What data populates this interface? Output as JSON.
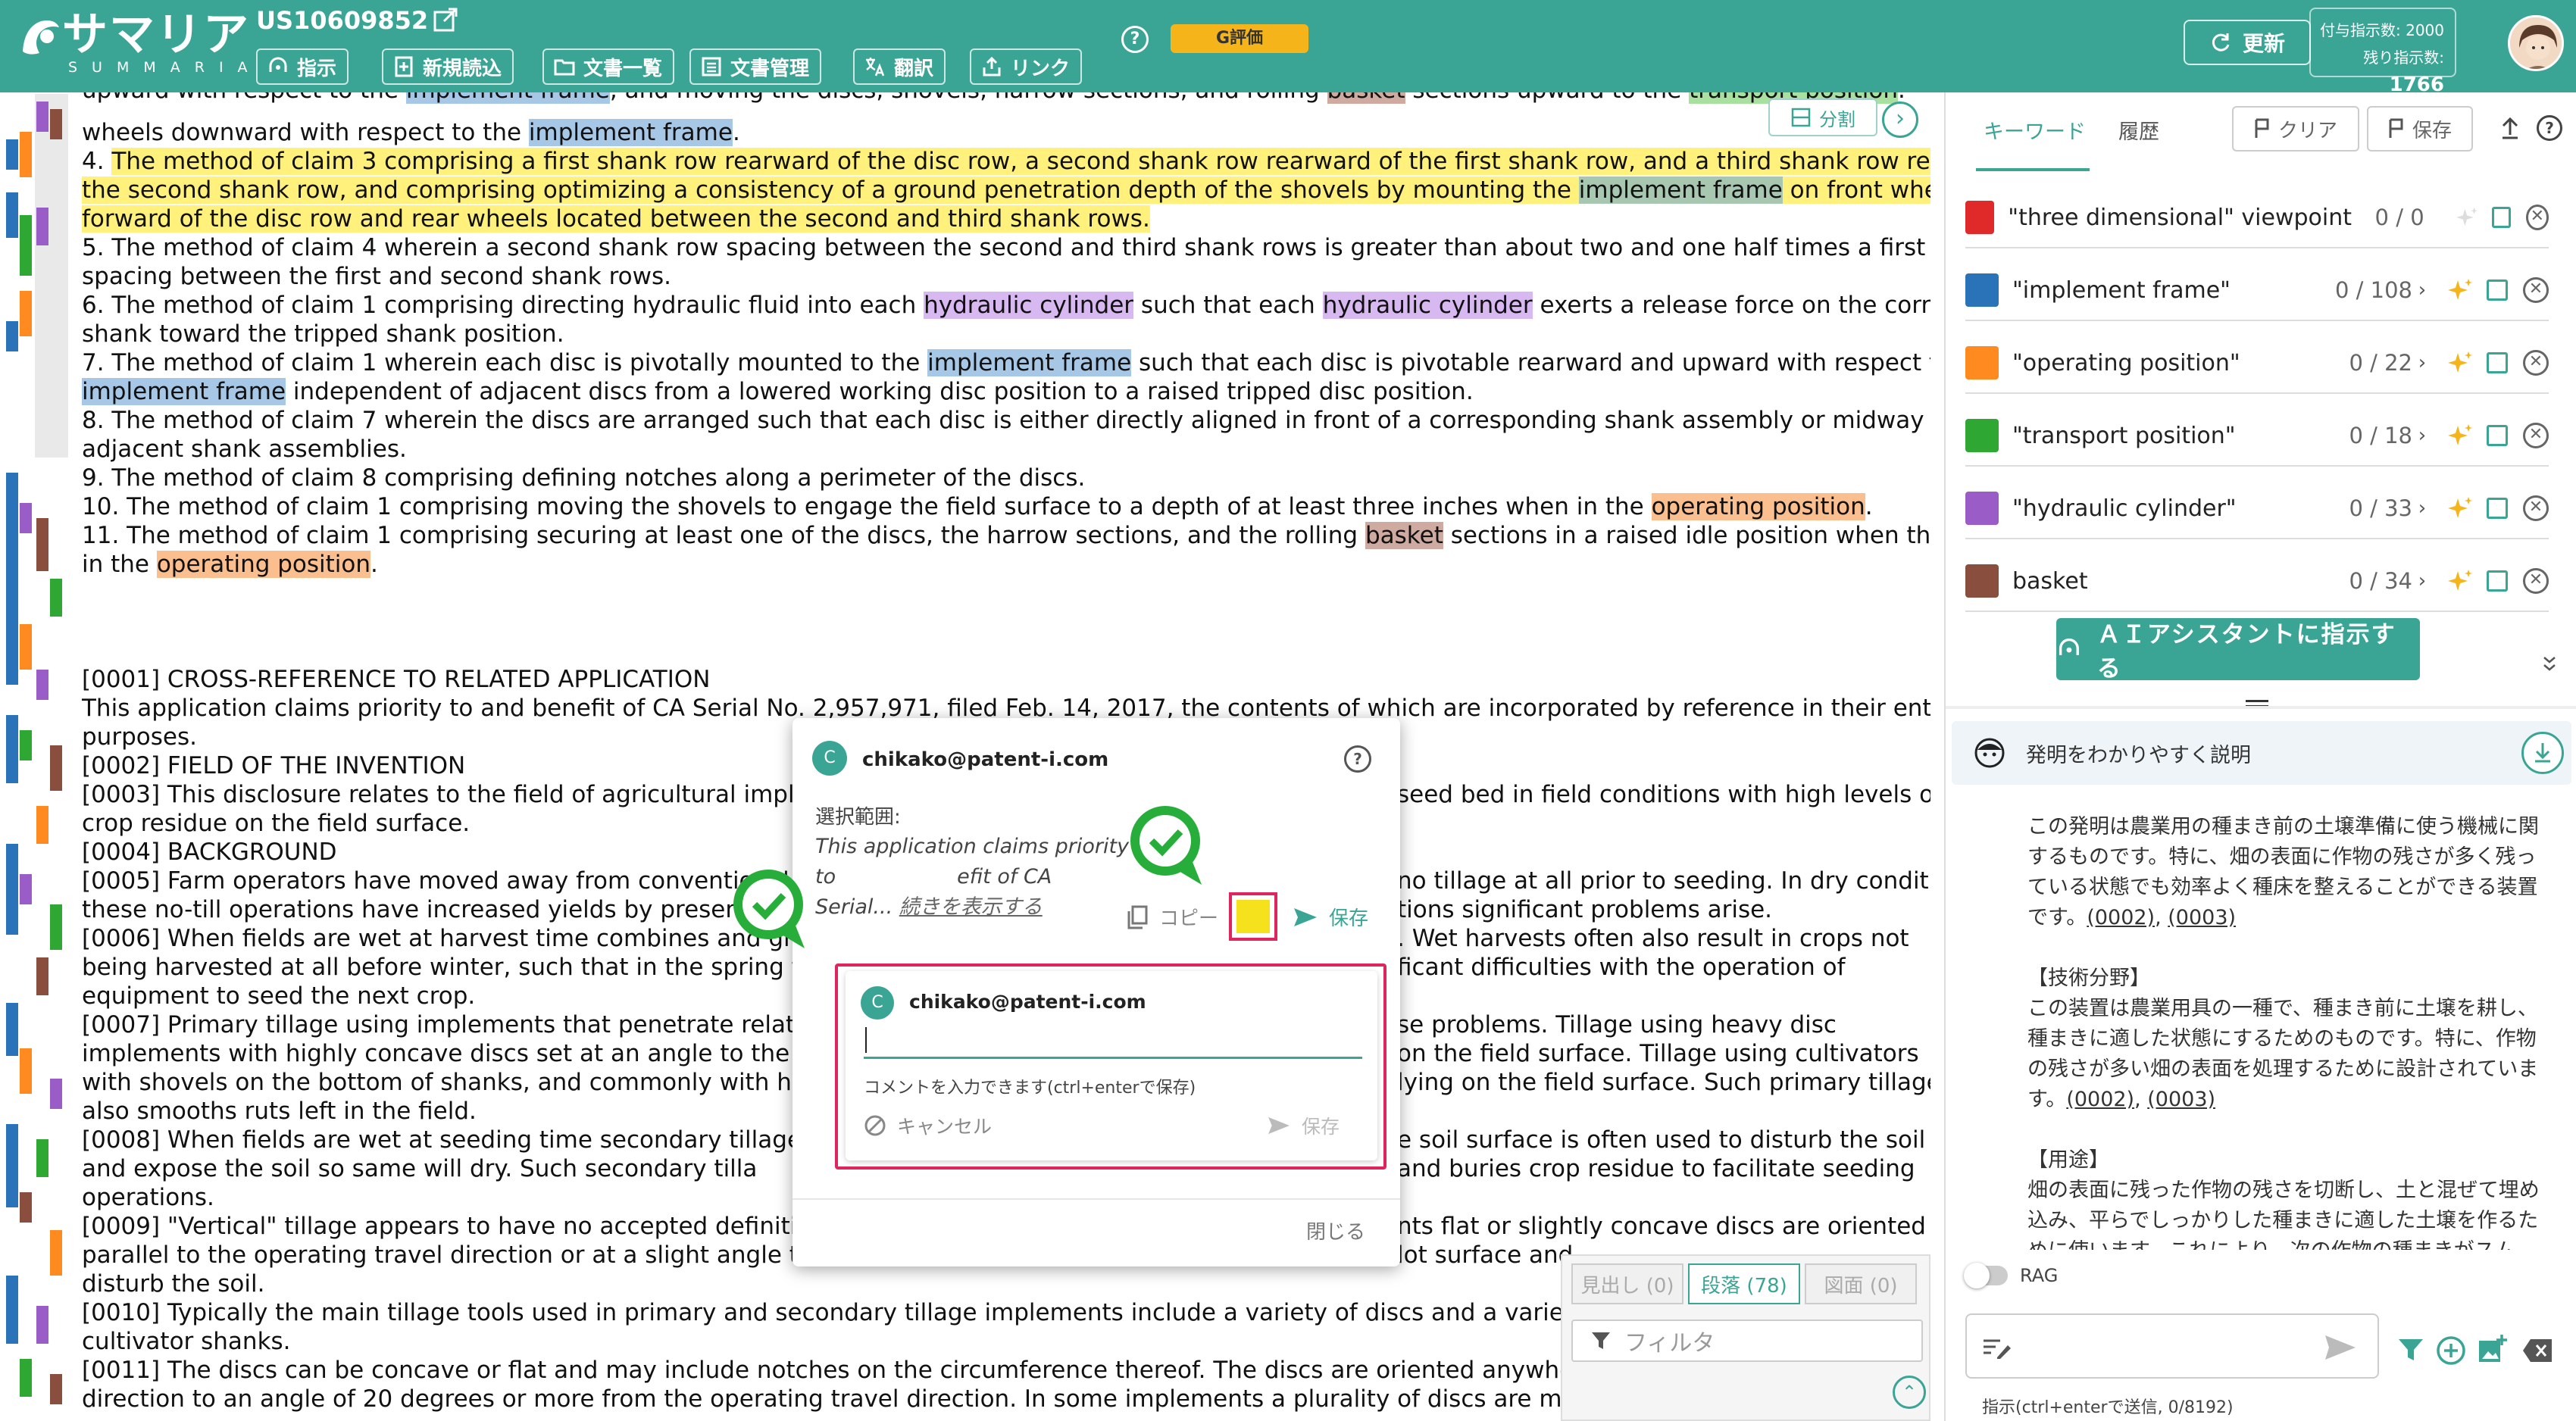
{
  "header": {
    "logo_jp": "サマリア",
    "logo_en": "SUMMARIA",
    "doc_id": "US10609852",
    "toolbar": [
      {
        "label": "指示",
        "icon": "ai-assistant-icon"
      },
      {
        "label": "新規読込",
        "icon": "add-document-icon"
      },
      {
        "label": "文書一覧",
        "icon": "folder-icon"
      },
      {
        "label": "文書管理",
        "icon": "document-list-icon"
      },
      {
        "label": "翻訳",
        "icon": "translate-icon"
      },
      {
        "label": "リンク",
        "icon": "share-icon"
      }
    ],
    "help": "?",
    "g_eval": "G評価",
    "update_label": "更新",
    "quota_granted_label": "付与指示数: 2000",
    "quota_remaining_label": "残り指示数:",
    "quota_remaining_value": "1766"
  },
  "document": {
    "lines": [
      "upward with respect to the implement frame, and moving the discs, shovels, harrow sections, and rolling basket sections upward to the transport position.",
      "wheels downward with respect to the implement frame.",
      "4. The method of claim 3 comprising a first shank row rearward of the disc row, a second shank row rearward of the first shank row, and a third shank row rearward of",
      "the second shank row, and comprising optimizing a consistency of a ground penetration depth of the shovels by mounting the implement frame on front wheels located",
      "forward of the disc row and rear wheels located between the second and third shank rows.",
      "5. The method of claim 4 wherein a second shank row spacing between the second and third shank rows is greater than about two and one half times a first shank row",
      "spacing between the first and second shank rows.",
      "6. The method of claim 1 comprising directing hydraulic fluid into each hydraulic cylinder such that each hydraulic cylinder exerts a release force on the corresponding",
      "shank toward the tripped shank position.",
      "7. The method of claim 1 wherein each disc is pivotally mounted to the implement frame such that each disc is pivotable rearward and upward with respect to the",
      "implement frame independent of adjacent discs from a lowered working disc position to a raised tripped disc position.",
      "8. The method of claim 7 wherein the discs are arranged such that each disc is either directly aligned in front of a corresponding shank assembly or midway between",
      "adjacent shank assemblies.",
      "9. The method of claim 8 comprising defining notches along a perimeter of the discs.",
      "10. The method of claim 1 comprising moving the shovels to engage the field surface to a depth of at least three inches when in the operating position.",
      "11. The method of claim 1 comprising securing at least one of the discs, the harrow sections, and the rolling basket sections in a raised idle position when the shovels are",
      "in the operating position.",
      "[0001] CROSS-REFERENCE TO RELATED APPLICATION",
      "This application claims priority to and benefit of CA Serial No. 2,957,971, filed Feb. 14, 2017, the contents of which are incorporated by reference in their entirety for all",
      "purposes.",
      "[0002] FIELD OF THE INVENTION",
      "[0003] This disclosure relates to the field of agricultural impleme",
      "crop residue on the field surface.",
      "[0004] BACKGROUND",
      "[0005] Farm operators have moved away from conventional",
      "these no-till operations have increased yields by preserving",
      "[0006] When fields are wet at harvest time combines and gra",
      "being harvested at all before winter, such that in the spring the cr",
      "equipment to seed the next crop.",
      "[0007] Primary tillage using implements that penetrate relatively d",
      "implements with highly concave discs set at an angle to the opera",
      "with shovels on the bottom of shanks, and commonly with harrow",
      "also smooths ruts left in the field.",
      "[0008] When fields are wet at seeding time secondary tillage usin",
      "and expose the soil so same will dry. Such secondary tilla",
      "operations.",
      "[0009] \"Vertical\" tillage appears to have no accepted definition b",
      "parallel to the operating travel direction or at a slight angle theret",
      "disturb the soil.",
      "[0010] Typically the main tillage tools used in primary and secondary tillage implements include a variety of discs and a variety of shove",
      "cultivator shanks.",
      "[0011] The discs can be concave or flat and may include notches on the circumference thereof. The discs are oriented anywhere from a",
      "direction to an angle of 20 degrees or more from the operating travel direction. In some implements a plurality of discs are mounted on"
    ],
    "right_fragments": [
      "seed bed in field conditions with high levels of",
      "no tillage at all prior to seeding. In dry conditions",
      "tions significant problems arise.",
      ". Wet harvests often also result in crops not",
      "ficant difficulties with the operation of",
      "se problems. Tillage using heavy disc",
      "on the field surface. Tillage using cultivators",
      "lying on the field surface. Such primary tillage",
      "e soil surface is often used to disturb the soil",
      "and buries crop residue to facilitate seeding",
      "nts flat or slightly concave discs are oriented",
      "lot surface and"
    ],
    "split_label": "分割",
    "next_label": "›"
  },
  "right_panel": {
    "tabs": [
      {
        "label": "キーワード",
        "active": true
      },
      {
        "label": "履歴",
        "active": false
      }
    ],
    "clear_label": "クリア",
    "save_label": "保存",
    "keywords": [
      {
        "term": "\"three dimensional\" viewpoint",
        "count": "0 / 0",
        "color": "#e02a2a",
        "chevron": false
      },
      {
        "term": "\"implement frame\"",
        "count": "0 / 108",
        "color": "#2b73b8",
        "chevron": true
      },
      {
        "term": "\"operating position\"",
        "count": "0 / 22",
        "color": "#ff8a1f",
        "chevron": true
      },
      {
        "term": "\"transport position\"",
        "count": "0 / 18",
        "color": "#2ea832",
        "chevron": true
      },
      {
        "term": "\"hydraulic cylinder\"",
        "count": "0 / 33",
        "color": "#9a5cc6",
        "chevron": true
      },
      {
        "term": "basket",
        "count": "0 / 34",
        "color": "#8a4e3e",
        "chevron": true
      }
    ],
    "ai_button": "ＡＩアシスタントに指示する",
    "explain_title": "発明をわかりやすく説明",
    "explain_paragraphs": [
      {
        "lines": [
          "この発明は農業用の種まき前の土壌準備に使う機械に関",
          "するものです。特に、畑の表面に作物の残さが多く残っ",
          "ている状態でも効率よく種床を整えることができる装置"
        ],
        "last": "です。",
        "refs": [
          "(0002)",
          "(0003)"
        ]
      },
      {
        "lines": [
          "【技術分野】",
          "この装置は農業用具の一種で、種まき前に土壌を耕し、",
          "種まきに適した状態にするためのものです。特に、作物",
          "の残さが多い畑の表面を処理するために設計されていま"
        ],
        "last": "す。",
        "refs": [
          "(0002)",
          "(0003)"
        ]
      },
      {
        "lines": [
          "【用途】",
          "畑の表面に残った作物の残さを切断し、土と混ぜて埋め",
          "込み、平らでしっかりした種まきに適した土壌を作るた",
          "めに使います。これにより、次の作物の種まきがスム"
        ],
        "last": "",
        "refs": []
      }
    ],
    "rag_label": "RAG",
    "chat_hint": "指示(ctrl+enterで送信, 0/8192)"
  },
  "filter": {
    "tabs": [
      {
        "label": "見出し (0)",
        "active": false
      },
      {
        "label": "段落 (78)",
        "active": true
      },
      {
        "label": "図面 (0)",
        "active": false
      }
    ],
    "placeholder": "フィルタ"
  },
  "popup": {
    "user": "chikako@patent-i.com",
    "avatar_letter": "C",
    "selection_label": "選択範囲:",
    "quote_1": "This application claims priority to",
    "quote_2": "efit of CA",
    "quote_3": "Serial...",
    "show_more": "続きを表示する",
    "copy_label": "コピー",
    "save_label": "保存",
    "comment_user": "chikako@patent-i.com",
    "comment_hint": "コメントを入力できます(ctrl+enterで保存)",
    "cancel_label": "キャンセル",
    "comment_save": "保存",
    "close_label": "閉じる",
    "highlight_color": "#f5e21c"
  }
}
